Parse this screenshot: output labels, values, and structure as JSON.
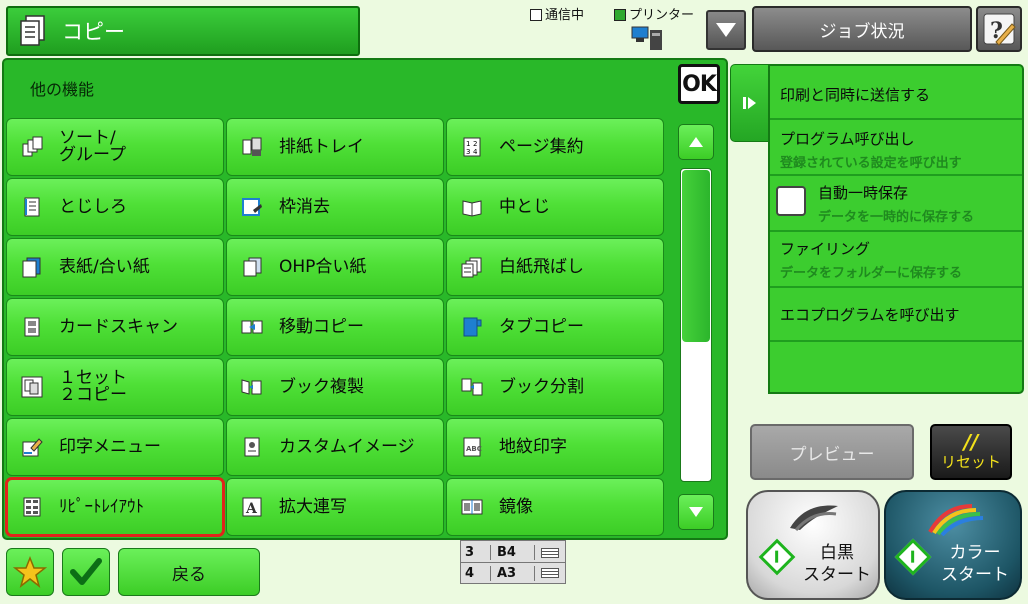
{
  "header": {
    "title": "コピー",
    "comm_label": "通信中",
    "printer_label": "プリンター",
    "job_status_label": "ジョブ状況"
  },
  "panel": {
    "title": "他の機能",
    "ok_label": "OK"
  },
  "functions": [
    {
      "lines": [
        "ソート/",
        "グループ"
      ],
      "icon": "sort-group-icon"
    },
    {
      "lines": [
        "排紙トレイ"
      ],
      "icon": "output-tray-icon"
    },
    {
      "lines": [
        "ページ集約"
      ],
      "icon": "page-combine-icon"
    },
    {
      "lines": [
        "とじしろ"
      ],
      "icon": "margin-shift-icon"
    },
    {
      "lines": [
        "枠消去"
      ],
      "icon": "edge-erase-icon"
    },
    {
      "lines": [
        "中とじ"
      ],
      "icon": "saddle-stitch-icon"
    },
    {
      "lines": [
        "表紙/合い紙"
      ],
      "icon": "covers-inserts-icon"
    },
    {
      "lines": [
        "OHP合い紙"
      ],
      "icon": "ohp-inserts-icon"
    },
    {
      "lines": [
        "白紙飛ばし"
      ],
      "icon": "blank-skip-icon"
    },
    {
      "lines": [
        "カードスキャン"
      ],
      "icon": "card-scan-icon"
    },
    {
      "lines": [
        "移動コピー"
      ],
      "icon": "image-shift-icon"
    },
    {
      "lines": [
        "タブコピー"
      ],
      "icon": "tab-copy-icon"
    },
    {
      "lines": [
        "１セット",
        "２コピー"
      ],
      "icon": "one-set-two-copy-icon"
    },
    {
      "lines": [
        "ブック複製"
      ],
      "icon": "book-copy-icon"
    },
    {
      "lines": [
        "ブック分割"
      ],
      "icon": "book-divide-icon"
    },
    {
      "lines": [
        "印字メニュー"
      ],
      "icon": "stamp-menu-icon"
    },
    {
      "lines": [
        "カスタムイメージ"
      ],
      "icon": "custom-image-icon"
    },
    {
      "lines": [
        "地紋印字"
      ],
      "icon": "pattern-print-icon"
    },
    {
      "lines": [
        "ﾘﾋﾟｰﾄﾚｲｱｳﾄ"
      ],
      "icon": "repeat-layout-icon"
    },
    {
      "lines": [
        "拡大連写"
      ],
      "icon": "multipage-enlarge-icon"
    },
    {
      "lines": [
        "鏡像"
      ],
      "icon": "mirror-image-icon"
    }
  ],
  "side_panel": {
    "items": [
      {
        "label": "印刷と同時に送信する",
        "sub": ""
      },
      {
        "label": "プログラム呼び出し",
        "sub": "登録されている設定を呼び出す"
      },
      {
        "label": "自動一時保存",
        "sub": "データを一時的に保存する"
      },
      {
        "label": "ファイリング",
        "sub": "データをフォルダーに保存する"
      },
      {
        "label": "エコプログラムを呼び出す",
        "sub": ""
      }
    ]
  },
  "buttons": {
    "preview_label": "プレビュー",
    "reset_symbol": "//",
    "reset_label": "リセット",
    "bw_start_line1": "白黒",
    "bw_start_line2": "スタート",
    "color_start_line1": "カラー",
    "color_start_line2": "スタート",
    "back_label": "戻る"
  },
  "trays": [
    {
      "no": "3",
      "size": "B4"
    },
    {
      "no": "4",
      "size": "A3"
    }
  ],
  "colors": {
    "accent": "#3ccd26",
    "selected_outline": "#e0241b",
    "reset_text": "#f2e11b"
  }
}
